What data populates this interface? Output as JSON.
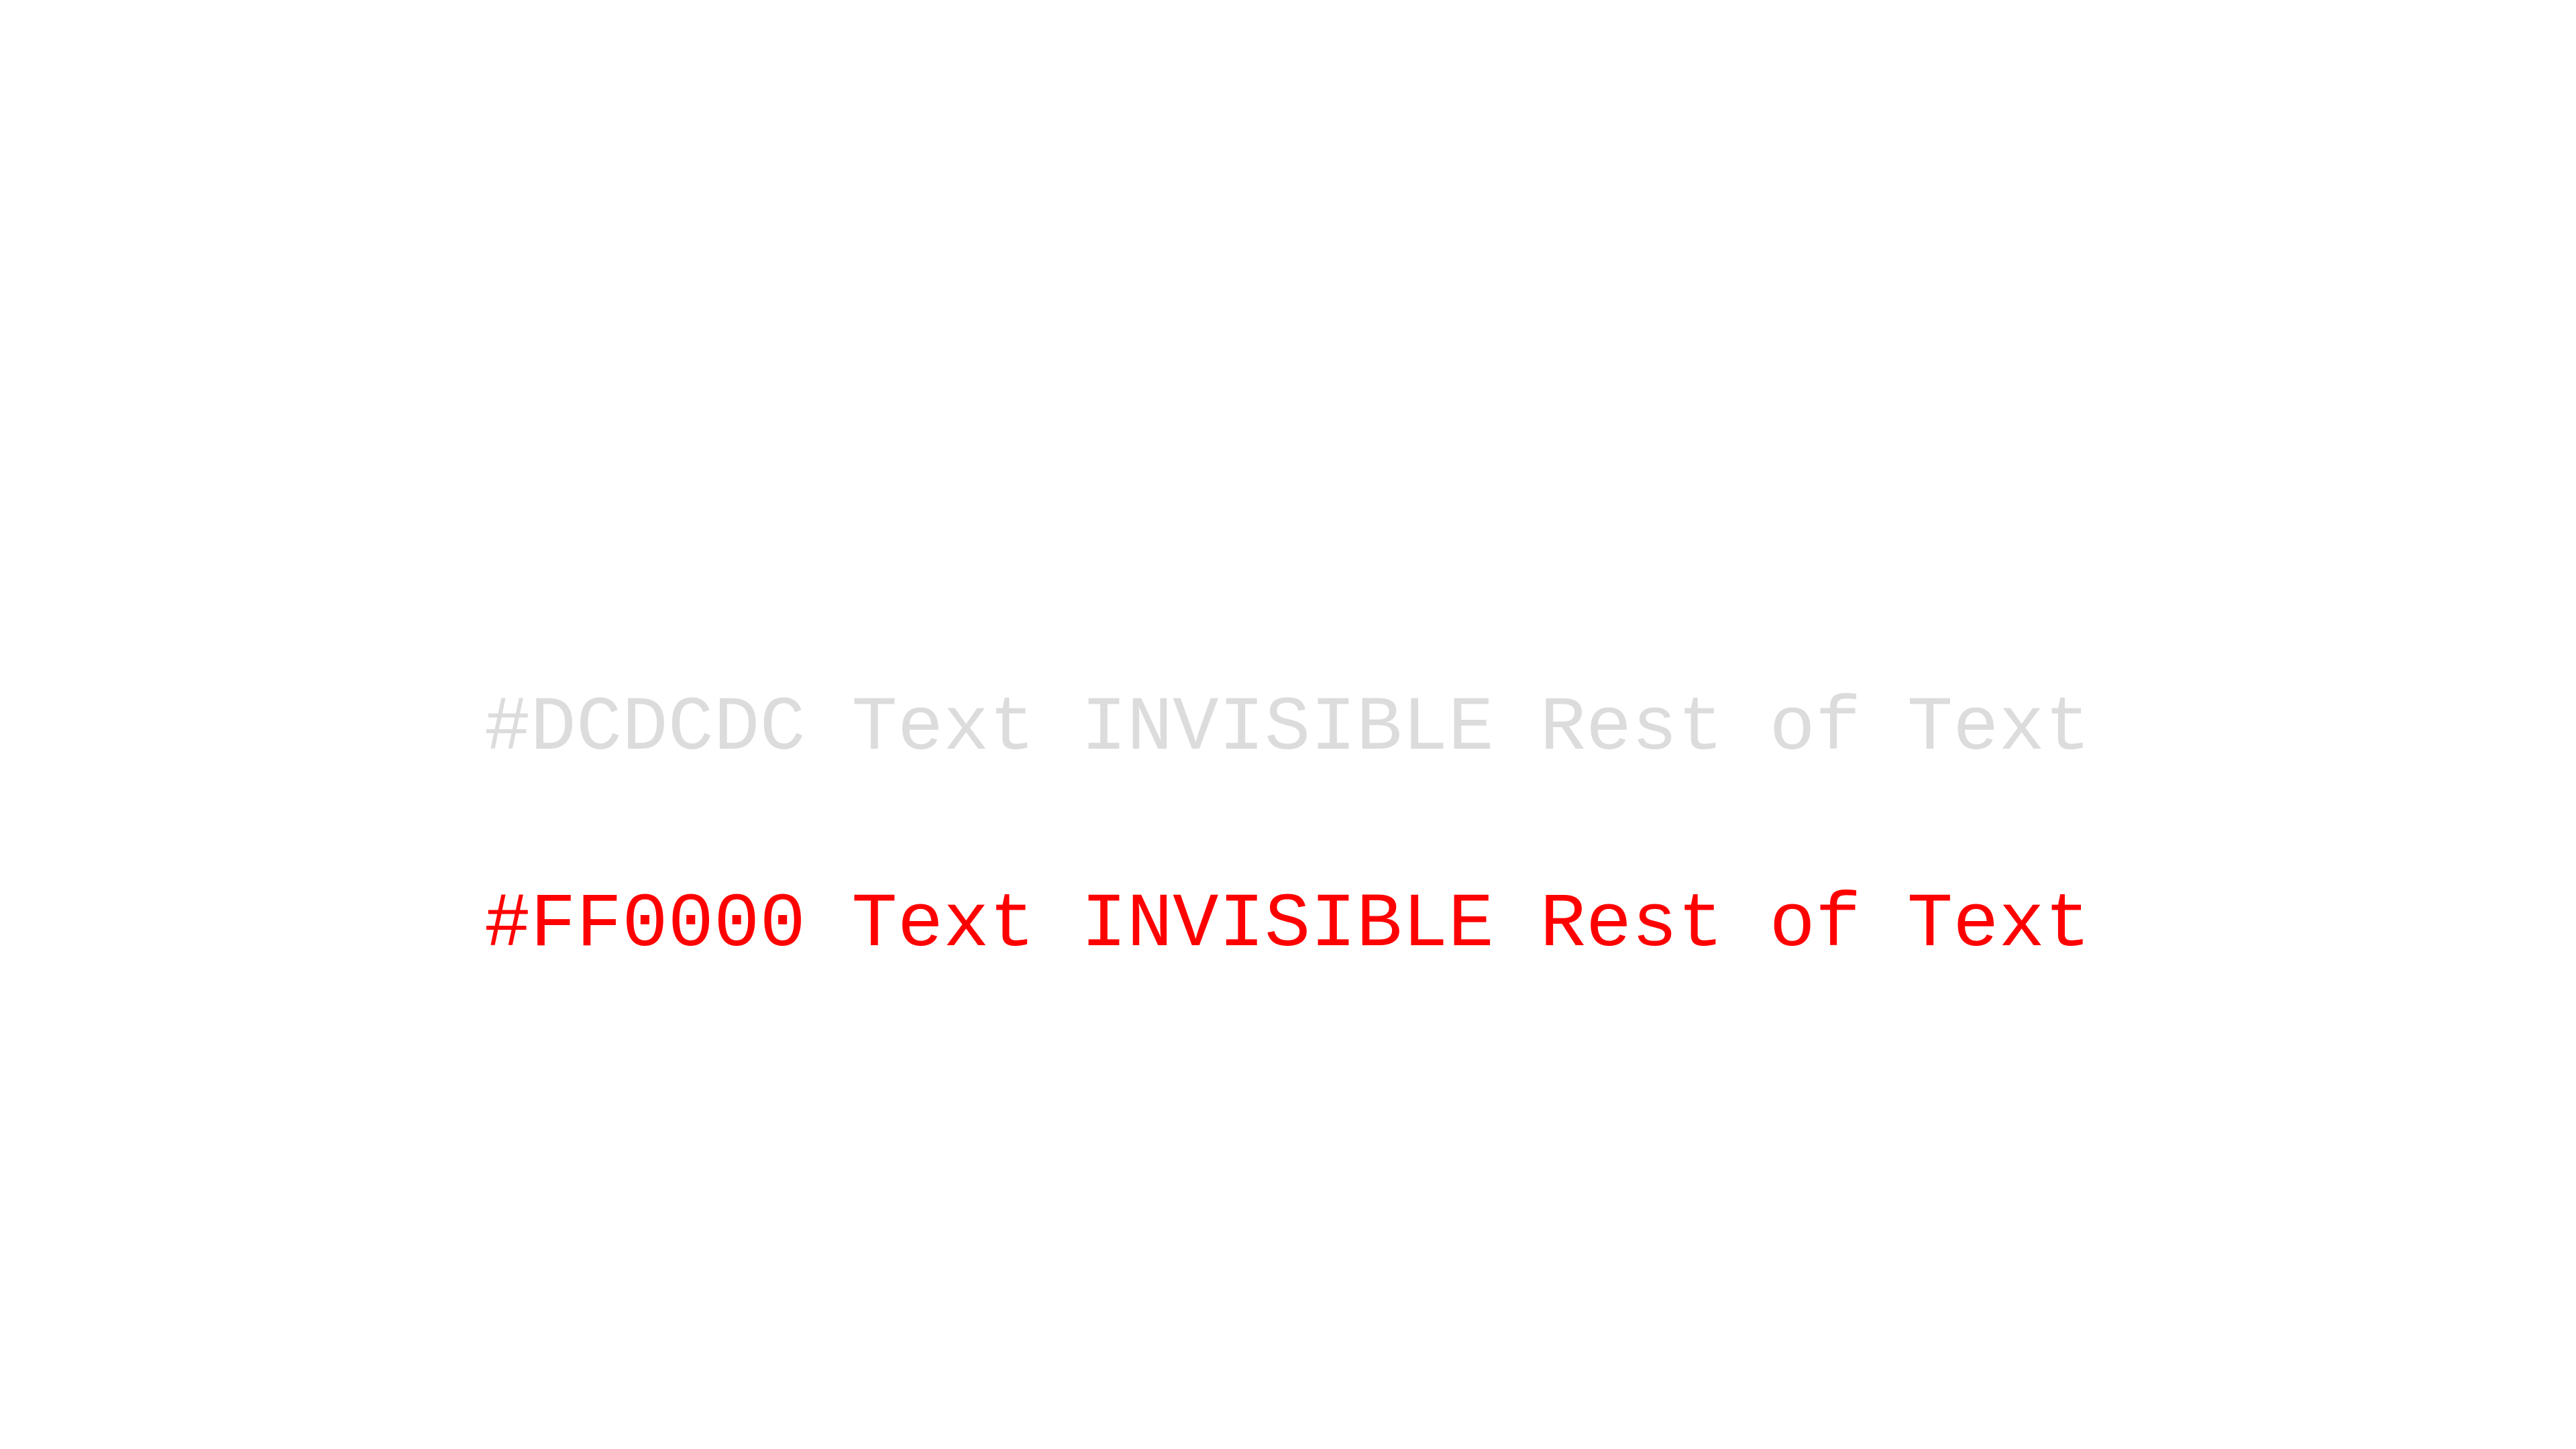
{
  "lines": [
    {
      "text": "#DCDCDC Text INVISIBLE Rest of Text",
      "color": "#DCDCDC"
    },
    {
      "text": "#FF0000 Text INVISIBLE Rest of Text",
      "color": "#FF0000"
    }
  ]
}
